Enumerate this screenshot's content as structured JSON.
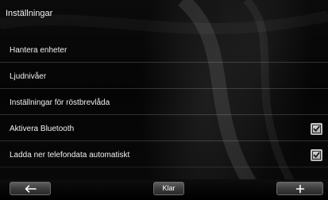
{
  "header": {
    "title": "Inställningar"
  },
  "settings": {
    "items": [
      {
        "label": "Hantera enheter",
        "has_checkbox": false
      },
      {
        "label": "Ljudnivåer",
        "has_checkbox": false
      },
      {
        "label": "Inställningar för röstbrevlåda",
        "has_checkbox": false
      },
      {
        "label": "Aktivera Bluetooth",
        "has_checkbox": true,
        "checked": true
      },
      {
        "label": "Ladda ner telefondata automatiskt",
        "has_checkbox": true,
        "checked": true
      }
    ]
  },
  "bottom_bar": {
    "back_icon": "arrow-left-icon",
    "done_label": "Klar",
    "add_icon": "plus-icon"
  },
  "colors": {
    "background": "#000000",
    "text": "#f0f0f0",
    "checkbox": "#c0c0c0"
  }
}
